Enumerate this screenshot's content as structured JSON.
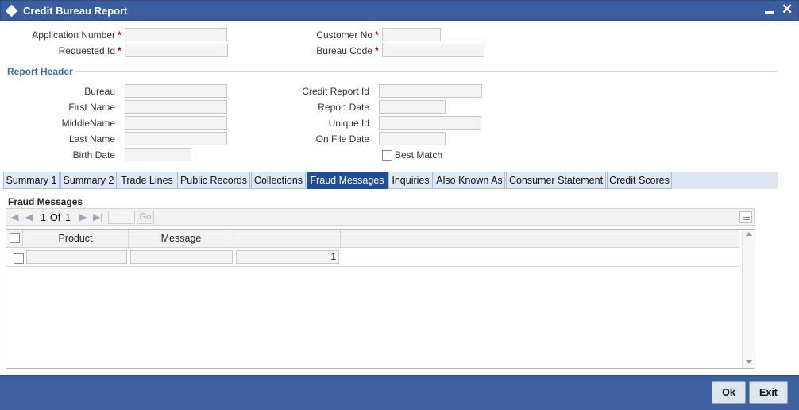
{
  "window": {
    "title": "Credit Bureau Report"
  },
  "header_fields": {
    "application_number": {
      "label": "Application Number",
      "value": ""
    },
    "requested_id": {
      "label": "Requested Id",
      "value": ""
    },
    "customer_no": {
      "label": "Customer No",
      "value": ""
    },
    "bureau_code": {
      "label": "Bureau Code",
      "value": ""
    },
    "required_mark": "*"
  },
  "report_header": {
    "title": "Report Header",
    "bureau": {
      "label": "Bureau",
      "value": ""
    },
    "first_name": {
      "label": "First Name",
      "value": ""
    },
    "middle_name": {
      "label": "MiddleName",
      "value": ""
    },
    "last_name": {
      "label": "Last Name",
      "value": ""
    },
    "birth_date": {
      "label": "Birth Date",
      "value": ""
    },
    "credit_report_id": {
      "label": "Credit Report Id",
      "value": ""
    },
    "report_date": {
      "label": "Report Date",
      "value": ""
    },
    "unique_id": {
      "label": "Unique Id",
      "value": ""
    },
    "on_file_date": {
      "label": "On File Date",
      "value": ""
    },
    "best_match": {
      "label": "Best Match",
      "checked": false
    }
  },
  "tabs": [
    {
      "label": "Summary 1",
      "active": false
    },
    {
      "label": "Summary 2",
      "active": false
    },
    {
      "label": "Trade Lines",
      "active": false
    },
    {
      "label": "Public Records",
      "active": false
    },
    {
      "label": "Collections",
      "active": false
    },
    {
      "label": "Fraud Messages",
      "active": true
    },
    {
      "label": "Inquiries",
      "active": false
    },
    {
      "label": "Also Known As",
      "active": false
    },
    {
      "label": "Consumer Statement",
      "active": false
    },
    {
      "label": "Credit Scores",
      "active": false
    }
  ],
  "fraud_messages": {
    "title": "Fraud Messages",
    "pager": {
      "current": "1",
      "of_label": "Of",
      "total": "1",
      "go_label": "Go"
    },
    "columns": [
      "Product",
      "Message"
    ],
    "rows": [
      {
        "product": "",
        "message": "",
        "value": "1"
      }
    ]
  },
  "footer": {
    "ok_label": "Ok",
    "exit_label": "Exit"
  },
  "colors": {
    "title_bar": "#3b5f9e",
    "active_tab": "#1f4e96",
    "section_title": "#3f6aa8",
    "required": "#cc0000"
  }
}
